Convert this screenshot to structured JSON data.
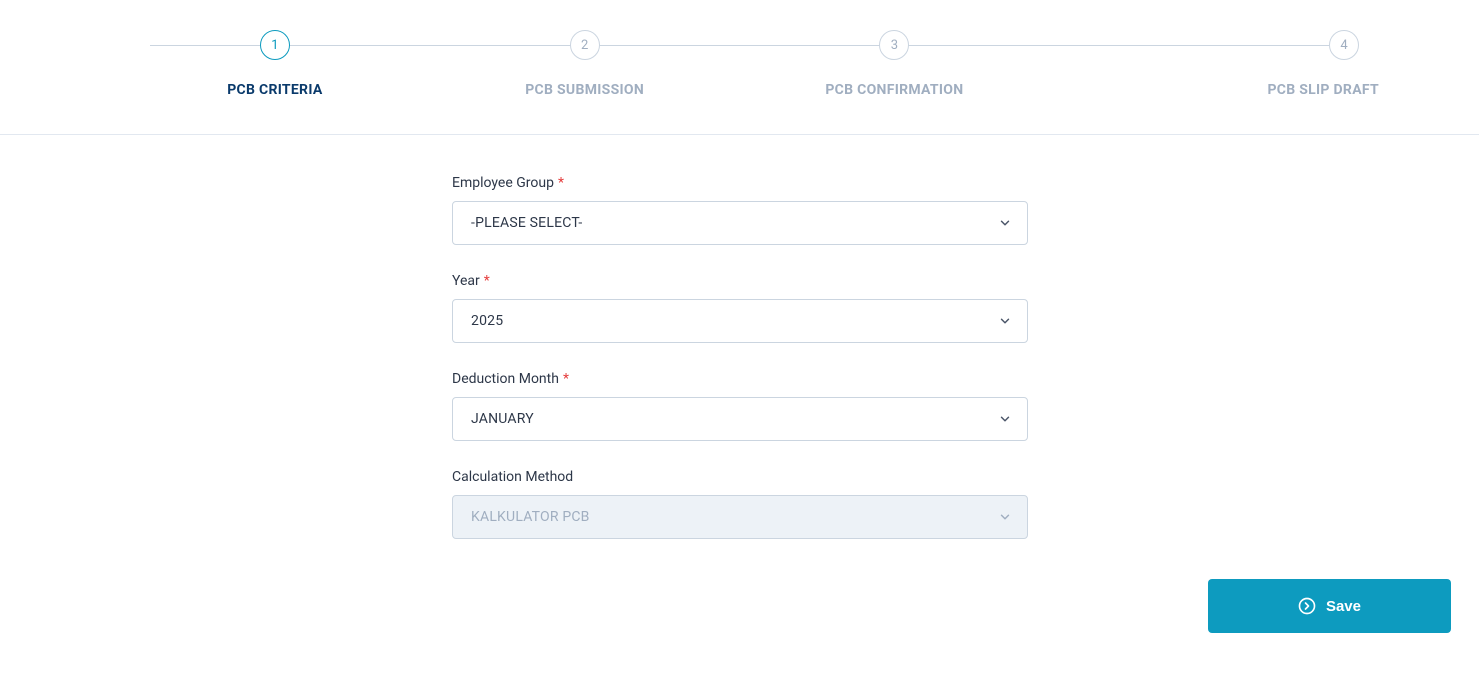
{
  "stepper": {
    "steps": [
      {
        "num": "1",
        "label": "PCB CRITERIA",
        "active": true
      },
      {
        "num": "2",
        "label": "PCB SUBMISSION",
        "active": false
      },
      {
        "num": "3",
        "label": "PCB CONFIRMATION",
        "active": false
      },
      {
        "num": "4",
        "label": "PCB SLIP DRAFT",
        "active": false
      }
    ]
  },
  "form": {
    "employee_group": {
      "label": "Employee Group",
      "value": "-PLEASE SELECT-",
      "required": true
    },
    "year": {
      "label": "Year",
      "value": "2025",
      "required": true
    },
    "deduction_month": {
      "label": "Deduction Month",
      "value": "JANUARY",
      "required": true
    },
    "calculation_method": {
      "label": "Calculation Method",
      "value": "KALKULATOR PCB",
      "required": false,
      "disabled": true
    }
  },
  "actions": {
    "save_label": "Save"
  }
}
